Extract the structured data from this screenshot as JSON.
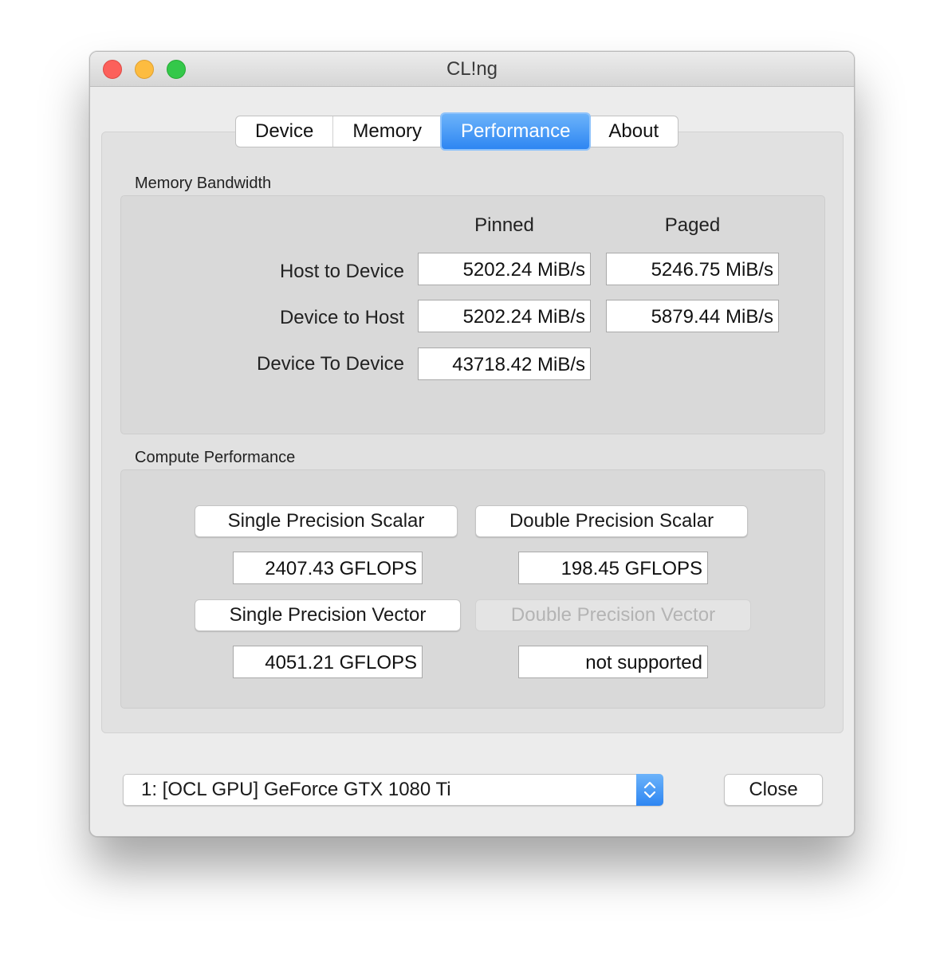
{
  "window": {
    "title": "CL!ng"
  },
  "tabs": [
    {
      "label": "Device",
      "active": false
    },
    {
      "label": "Memory",
      "active": false
    },
    {
      "label": "Performance",
      "active": true
    },
    {
      "label": "About",
      "active": false
    }
  ],
  "memory_bandwidth": {
    "label": "Memory Bandwidth",
    "col_pinned": "Pinned",
    "col_paged": "Paged",
    "rows": [
      {
        "label": "Host to Device",
        "pinned": "5202.24 MiB/s",
        "paged": "5246.75 MiB/s"
      },
      {
        "label": "Device to Host",
        "pinned": "5202.24 MiB/s",
        "paged": "5879.44 MiB/s"
      },
      {
        "label": "Device To Device",
        "pinned": "43718.42 MiB/s"
      }
    ]
  },
  "compute_performance": {
    "label": "Compute Performance",
    "single_scalar": {
      "button": "Single Precision Scalar",
      "value": "2407.43 GFLOPS"
    },
    "double_scalar": {
      "button": "Double Precision Scalar",
      "value": "198.45 GFLOPS"
    },
    "single_vector": {
      "button": "Single Precision Vector",
      "value": "4051.21 GFLOPS"
    },
    "double_vector": {
      "button": "Double Precision Vector",
      "value": "not supported",
      "disabled": true
    }
  },
  "footer": {
    "device_select": "1: [OCL GPU] GeForce GTX 1080 Ti",
    "close_label": "Close"
  },
  "colors": {
    "accent": "#2e86f2",
    "close_light": "#fc605b",
    "minimize_light": "#fdbc40",
    "zoom_light": "#34c84a"
  }
}
